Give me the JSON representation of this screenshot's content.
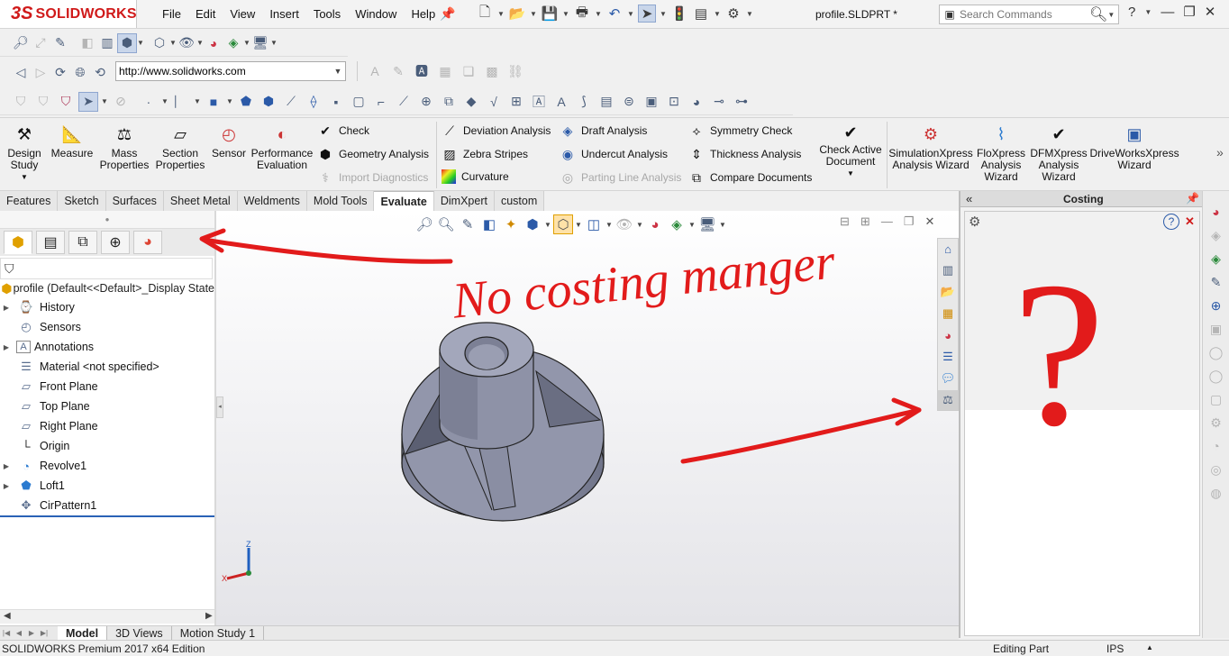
{
  "app": {
    "logo_mark": "3S",
    "logo_text": "SOLIDWORKS",
    "doc_title": "profile.SLDPRT *"
  },
  "menu": [
    "File",
    "Edit",
    "View",
    "Insert",
    "Tools",
    "Window",
    "Help"
  ],
  "search": {
    "placeholder": "Search Commands"
  },
  "url_bar": {
    "value": "http://www.solidworks.com"
  },
  "command_manager": {
    "big": [
      {
        "label": "Design Study",
        "icon": "design-study-icon"
      },
      {
        "label": "Measure",
        "icon": "measure-icon"
      },
      {
        "label": "Mass Properties",
        "icon": "mass-properties-icon"
      },
      {
        "label": "Section Properties",
        "icon": "section-properties-icon"
      },
      {
        "label": "Sensor",
        "icon": "sensor-icon"
      },
      {
        "label": "Performance Evaluation",
        "icon": "performance-icon"
      }
    ],
    "col1": [
      {
        "label": "Check",
        "enabled": true
      },
      {
        "label": "Geometry Analysis",
        "enabled": true
      },
      {
        "label": "Import Diagnostics",
        "enabled": false
      }
    ],
    "col2": [
      {
        "label": "Deviation Analysis",
        "enabled": true
      },
      {
        "label": "Zebra Stripes",
        "enabled": true
      },
      {
        "label": "Curvature",
        "enabled": true
      }
    ],
    "col3": [
      {
        "label": "Draft Analysis",
        "enabled": true
      },
      {
        "label": "Undercut Analysis",
        "enabled": true
      },
      {
        "label": "Parting Line Analysis",
        "enabled": false
      }
    ],
    "col4": [
      {
        "label": "Symmetry Check",
        "enabled": true
      },
      {
        "label": "Thickness Analysis",
        "enabled": true
      },
      {
        "label": "Compare Documents",
        "enabled": true
      }
    ],
    "check_active": "Check Active Document",
    "xpress": [
      {
        "label": "SimulationXpress Analysis Wizard"
      },
      {
        "label": "FloXpress Analysis Wizard"
      },
      {
        "label": "DFMXpress Analysis Wizard"
      },
      {
        "label": "DriveWorksXpress Wizard"
      }
    ]
  },
  "tabs": [
    {
      "label": "Features",
      "active": false
    },
    {
      "label": "Sketch",
      "active": false
    },
    {
      "label": "Surfaces",
      "active": false
    },
    {
      "label": "Sheet Metal",
      "active": false
    },
    {
      "label": "Weldments",
      "active": false
    },
    {
      "label": "Mold Tools",
      "active": false
    },
    {
      "label": "Evaluate",
      "active": true
    },
    {
      "label": "DimXpert",
      "active": false
    },
    {
      "label": "custom",
      "active": false
    }
  ],
  "feature_manager": {
    "root": "profile  (Default<<Default>_Display State",
    "items": [
      {
        "label": "History",
        "icon": "history-icon",
        "expandable": true
      },
      {
        "label": "Sensors",
        "icon": "sensors-icon",
        "expandable": false
      },
      {
        "label": "Annotations",
        "icon": "annotations-icon",
        "expandable": true
      },
      {
        "label": "Material <not specified>",
        "icon": "material-icon",
        "expandable": false
      },
      {
        "label": "Front Plane",
        "icon": "plane-icon",
        "expandable": false
      },
      {
        "label": "Top Plane",
        "icon": "plane-icon",
        "expandable": false
      },
      {
        "label": "Right Plane",
        "icon": "plane-icon",
        "expandable": false
      },
      {
        "label": "Origin",
        "icon": "origin-icon",
        "expandable": false
      },
      {
        "label": "Revolve1",
        "icon": "revolve-icon",
        "expandable": true
      },
      {
        "label": "Loft1",
        "icon": "loft-icon",
        "expandable": true
      },
      {
        "label": "CirPattern1",
        "icon": "cirpattern-icon",
        "expandable": false
      }
    ]
  },
  "bottom_tabs": [
    {
      "label": "Model",
      "active": true
    },
    {
      "label": "3D Views",
      "active": false
    },
    {
      "label": "Motion Study 1",
      "active": false
    }
  ],
  "status": {
    "left": "SOLIDWORKS Premium 2017 x64 Edition",
    "mode": "Editing Part",
    "units": "IPS"
  },
  "task_pane": {
    "title": "Costing",
    "help": "?",
    "close": "✕",
    "collapse": "«"
  },
  "annotation": {
    "text": "No costing manger",
    "mark": "?",
    "color": "#e21b1b"
  },
  "triad": {
    "z": "Z",
    "x": "X"
  }
}
